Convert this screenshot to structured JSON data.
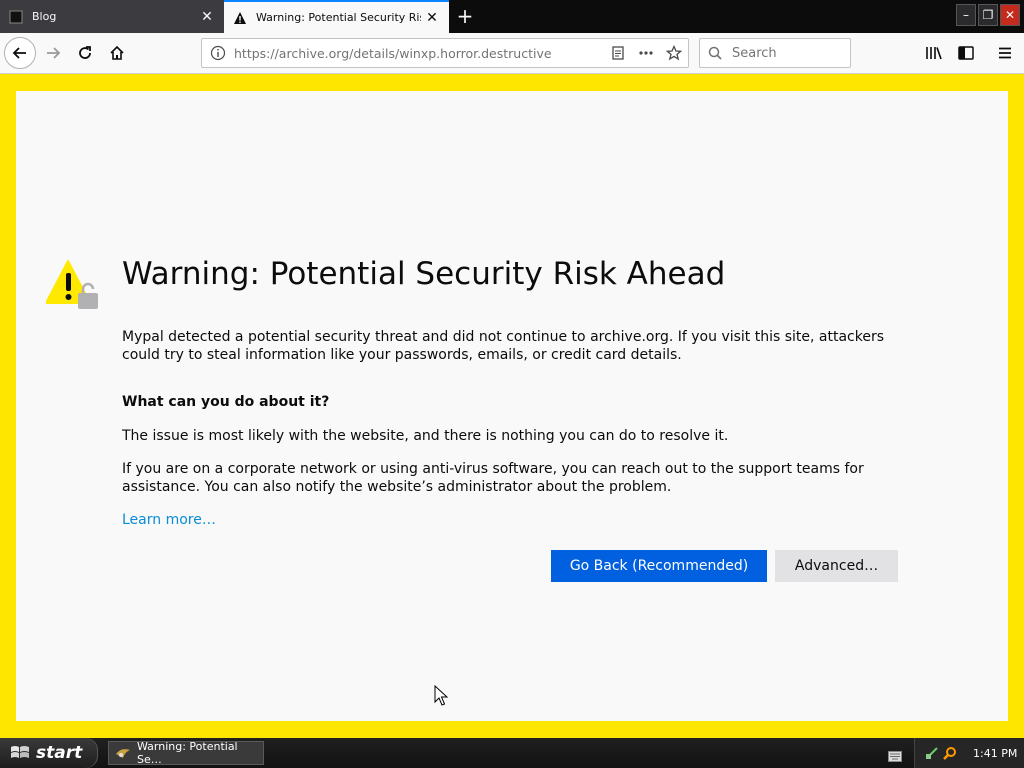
{
  "tabs": [
    {
      "label": "Blog"
    },
    {
      "label": "Warning: Potential Security Risk A"
    }
  ],
  "window_controls": {
    "minimize": "–",
    "restore": "❐",
    "close": "✕"
  },
  "navbar": {
    "url": "https://archive.org/details/winxp.horror.destructive",
    "search_placeholder": "Search"
  },
  "page": {
    "title": "Warning: Potential Security Risk Ahead",
    "intro": "Mypal detected a potential security threat and did not continue to archive.org. If you visit this site, attackers could try to steal information like your passwords, emails, or credit card details.",
    "heading": "What can you do about it?",
    "p2": "The issue is most likely with the website, and there is nothing you can do to resolve it.",
    "p3": "If you are on a corporate network or using anti-virus software, you can reach out to the support teams for assistance. You can also notify the website’s administrator about the problem.",
    "learn_more": "Learn more…",
    "go_back": "Go Back (Recommended)",
    "advanced": "Advanced…"
  },
  "taskbar": {
    "start": "start",
    "task_item": "Warning: Potential Se…",
    "clock": "1:41 PM"
  },
  "colors": {
    "page_border": "#ffe600",
    "primary_button": "#0060df",
    "link": "#0a8dd6"
  }
}
